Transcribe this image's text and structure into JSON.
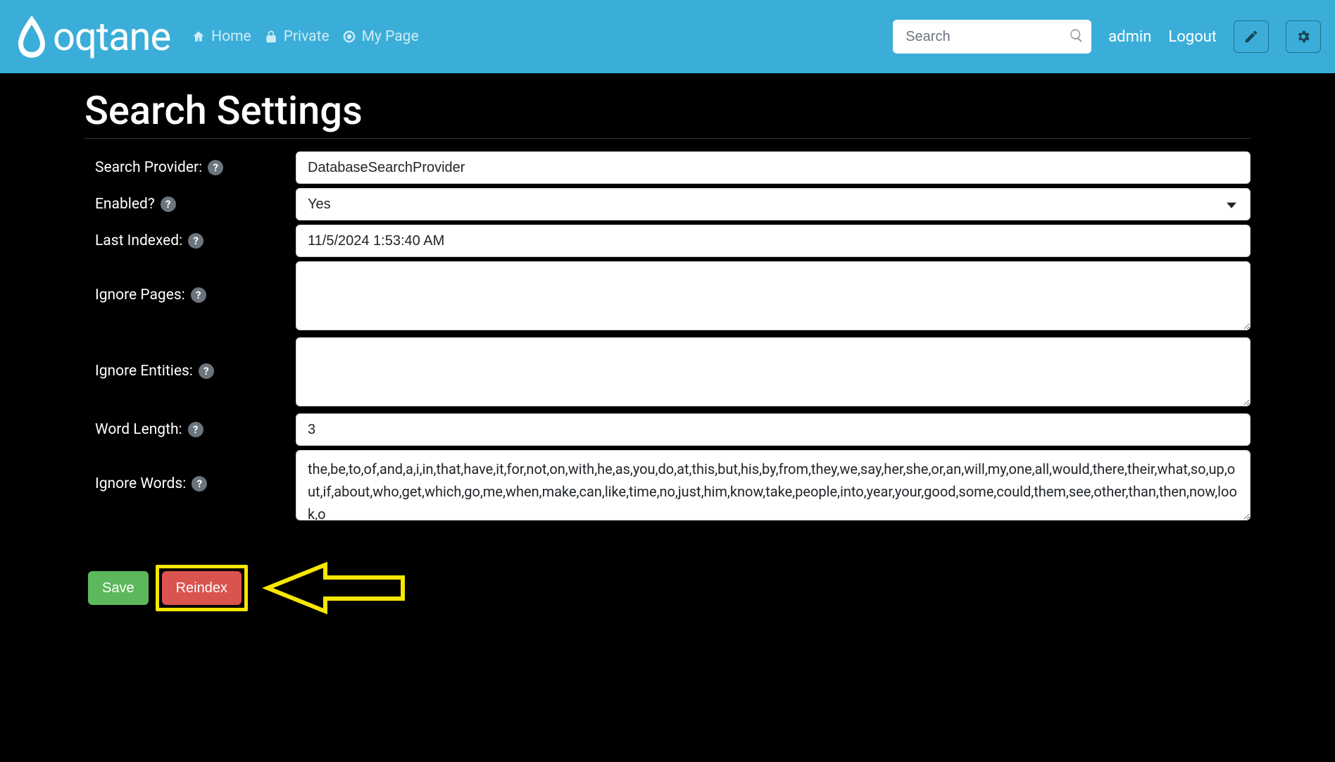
{
  "brand": {
    "name": "oqtane"
  },
  "nav": {
    "home": "Home",
    "private": "Private",
    "mypage": "My Page"
  },
  "header": {
    "search_placeholder": "Search",
    "user": "admin",
    "logout": "Logout"
  },
  "page": {
    "title": "Search Settings"
  },
  "form": {
    "search_provider": {
      "label": "Search Provider:",
      "value": "DatabaseSearchProvider"
    },
    "enabled": {
      "label": "Enabled?",
      "value": "Yes"
    },
    "last_indexed": {
      "label": "Last Indexed:",
      "value": "11/5/2024 1:53:40 AM"
    },
    "ignore_pages": {
      "label": "Ignore Pages:",
      "value": ""
    },
    "ignore_entities": {
      "label": "Ignore Entities:",
      "value": ""
    },
    "word_length": {
      "label": "Word Length:",
      "value": "3"
    },
    "ignore_words": {
      "label": "Ignore Words:",
      "value": "the,be,to,of,and,a,i,in,that,have,it,for,not,on,with,he,as,you,do,at,this,but,his,by,from,they,we,say,her,she,or,an,will,my,one,all,would,there,their,what,so,up,out,if,about,who,get,which,go,me,when,make,can,like,time,no,just,him,know,take,people,into,year,your,good,some,could,them,see,other,than,then,now,look,o"
    }
  },
  "buttons": {
    "save": "Save",
    "reindex": "Reindex"
  }
}
